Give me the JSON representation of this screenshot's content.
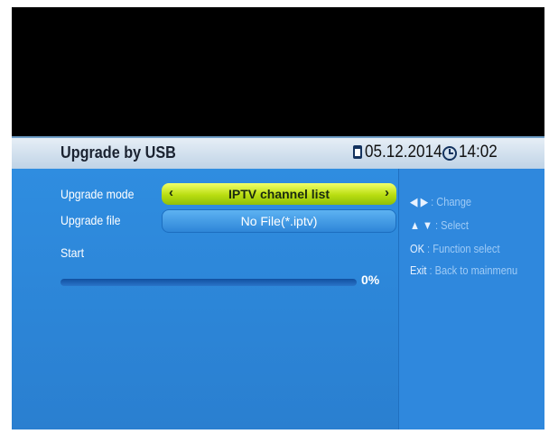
{
  "header": {
    "title": "Upgrade by USB",
    "date": "05.12.2014",
    "time": "14:02"
  },
  "form": {
    "mode_label": "Upgrade mode",
    "mode_value": "IPTV channel list",
    "mode_left_arrow": "‹",
    "mode_right_arrow": "›",
    "file_label": "Upgrade file",
    "file_value": "No File(*.iptv)",
    "start_label": "Start"
  },
  "progress": {
    "value": 0,
    "label": "0%"
  },
  "help": [
    {
      "key": "◀ ▶",
      "text": ": Change"
    },
    {
      "key": "▲ ▼",
      "text": ": Select"
    },
    {
      "key": "OK",
      "text": ": Function select"
    },
    {
      "key": "Exit",
      "text": ": Back to mainmenu"
    }
  ],
  "colors": {
    "accent_highlight": "#c8e61a",
    "panel_blue": "#2f88dd",
    "progress_fill": "#f4e000"
  }
}
